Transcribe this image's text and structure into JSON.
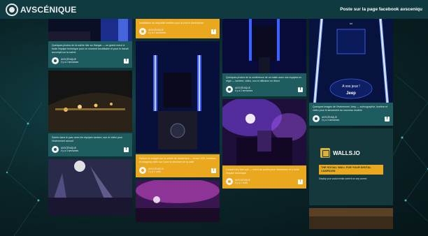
{
  "header": {
    "brand": "AVSCÉNIQUE",
    "link": "Poste sur la page facebook avsceniqu"
  },
  "columns": {
    "col1": {
      "post1": {
        "caption": "Quelques photos de la soirée hier au Hangar — un grand merci à toute l'équipe technique pour ce moment inoubliable et pour le travail accompli sur la scène",
        "author": "AVSCÉNIQUE",
        "date": "il y a 2 semaines"
      },
      "post2": {
        "caption": "Soirée dans le parc avec les équipes lumière, son et vidéo pour l'événement annuel",
        "author": "AVSCÉNIQUE",
        "date": "il y a 3 semaines"
      }
    },
    "col2": {
      "post1": {
        "caption": "Installation du dispositif lumière pour la soirée d'entreprise",
        "author": "AVSCÉNIQUE",
        "date": "il y a 2 semaines"
      },
      "post2": {
        "caption": "Retour en images sur la soirée de lancement — écran LED, lumières et mapping vidéo sur toute la structure de la salle",
        "author": "AVSCÉNIQUE",
        "date": "il y a 1 mois"
      }
    },
    "col3": {
      "post1": {
        "caption": "Quelques photos de la conférence de ce matin avec nos équipes en régie — lumière, vidéo, son et diffusion en direct",
        "author": "AVSCÉNIQUE",
        "date": "il y a 2 semaines"
      },
      "post2": {
        "caption": "Concert live hier soir — merci au public pour l'ambiance et à toute l'équipe technique",
        "author": "AVSCÉNIQUE",
        "date": "il y a 1 mois"
      }
    },
    "col4": {
      "post1": {
        "overlay_top": "ici",
        "overlay_mid": "A vos jeux !",
        "overlay_brand": "Jeep",
        "caption": "Quelques images de l'événement Jeep — scénographie, lumière et vidéo pour le lancement du nouveau modèle",
        "author": "AVSCÉNIQUE",
        "date": "il y a 3 semaines"
      },
      "promo": {
        "name": "WALLS.IO",
        "banner": "THE SOCIAL WALL FOR YOUR DIGITAL CAMPAIGN",
        "sub": "Display your social media content on any screen"
      }
    }
  },
  "icons": {
    "facebook": "f"
  },
  "colors": {
    "topbar": "#0f3a40",
    "teal_card": "#1e5c5f",
    "orange_card": "#e9a81d"
  }
}
